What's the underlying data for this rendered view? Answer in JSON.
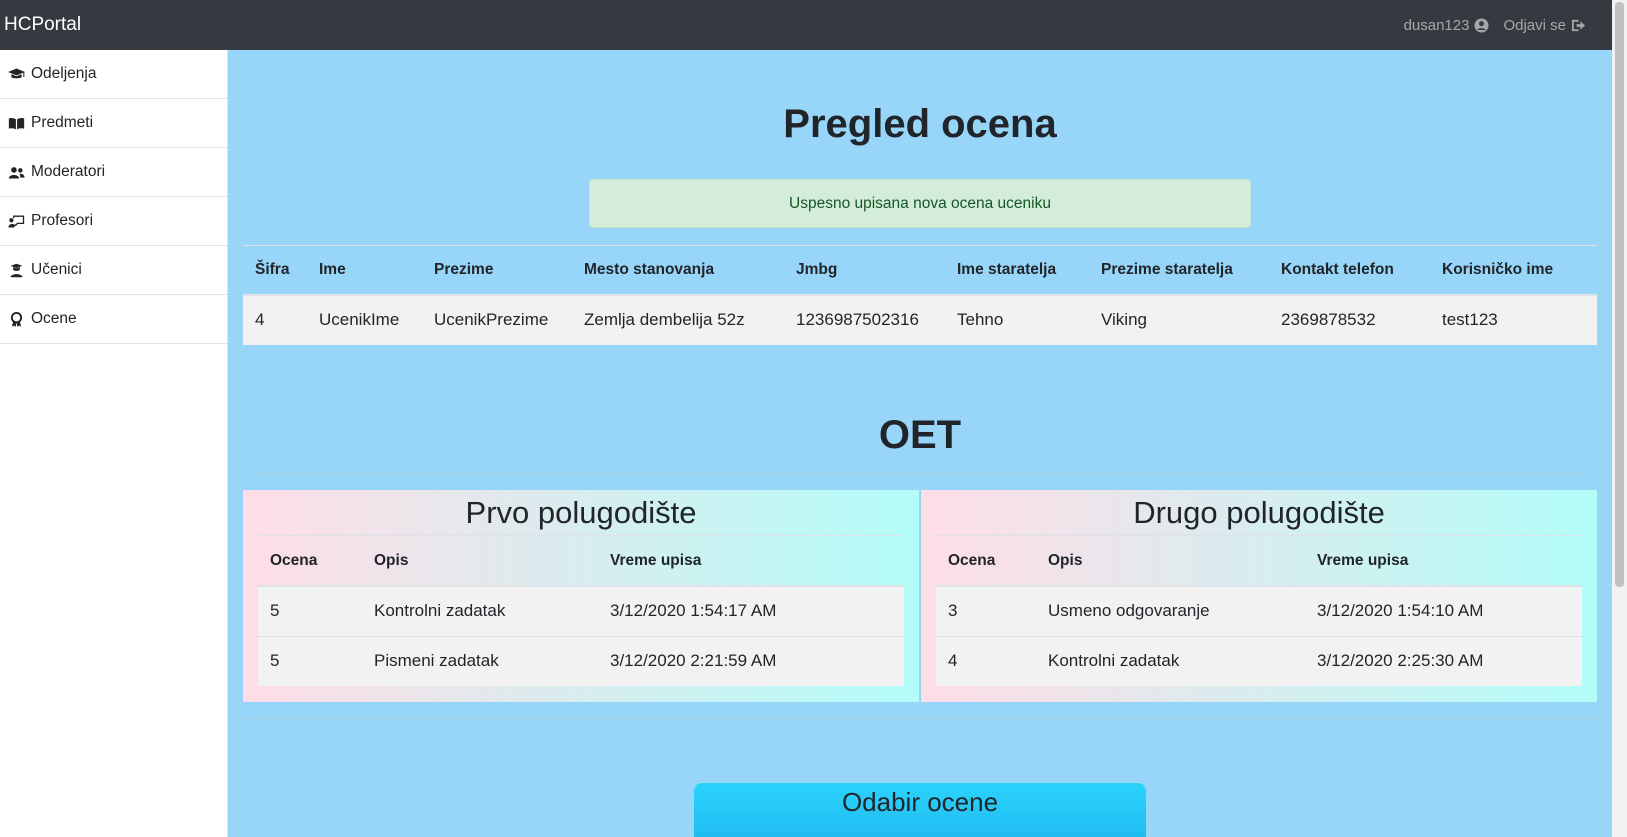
{
  "navbar": {
    "brand": "HCPortal",
    "user": "dusan123",
    "logout": "Odjavi se"
  },
  "sidebar": {
    "items": [
      {
        "label": "Odeljenja",
        "icon": "graduation-cap-icon"
      },
      {
        "label": "Predmeti",
        "icon": "book-open-icon"
      },
      {
        "label": "Moderatori",
        "icon": "users-icon"
      },
      {
        "label": "Profesori",
        "icon": "chalkboard-teacher-icon"
      },
      {
        "label": "Učenici",
        "icon": "user-graduate-icon"
      },
      {
        "label": "Ocene",
        "icon": "award-icon"
      }
    ]
  },
  "main": {
    "title": "Pregled ocena",
    "alert": "Uspesno upisana nova ocena uceniku",
    "student_table": {
      "headers": [
        "Šifra",
        "Ime",
        "Prezime",
        "Mesto stanovanja",
        "Jmbg",
        "Ime staratelja",
        "Prezime staratelja",
        "Kontakt telefon",
        "Korisničko ime"
      ],
      "row": [
        "4",
        "UcenikIme",
        "UcenikPrezime",
        "Zemlja dembelija 52z",
        "1236987502316",
        "Tehno",
        "Viking",
        "2369878532",
        "test123"
      ]
    },
    "subject": "OET",
    "semesters": [
      {
        "title": "Prvo polugodište",
        "headers": [
          "Ocena",
          "Opis",
          "Vreme upisa"
        ],
        "rows": [
          [
            "5",
            "Kontrolni zadatak",
            "3/12/2020 1:54:17 AM"
          ],
          [
            "5",
            "Pismeni zadatak",
            "3/12/2020 2:21:59 AM"
          ]
        ]
      },
      {
        "title": "Drugo polugodište",
        "headers": [
          "Ocena",
          "Opis",
          "Vreme upisa"
        ],
        "rows": [
          [
            "3",
            "Usmeno odgovaranje",
            "3/12/2020 1:54:10 AM"
          ],
          [
            "4",
            "Kontrolni zadatak",
            "3/12/2020 2:25:30 AM"
          ]
        ]
      }
    ],
    "choose_grade_title": "Odabir ocene"
  },
  "colors": {
    "navbar_bg": "#343a40",
    "page_bg": "#97d5f9",
    "alert_bg": "#d4edda",
    "alert_text": "#155724",
    "semester_gradient_start": "#ffdde6",
    "semester_gradient_end": "#b2fdf8",
    "choose_box": "#2bd3fb"
  }
}
